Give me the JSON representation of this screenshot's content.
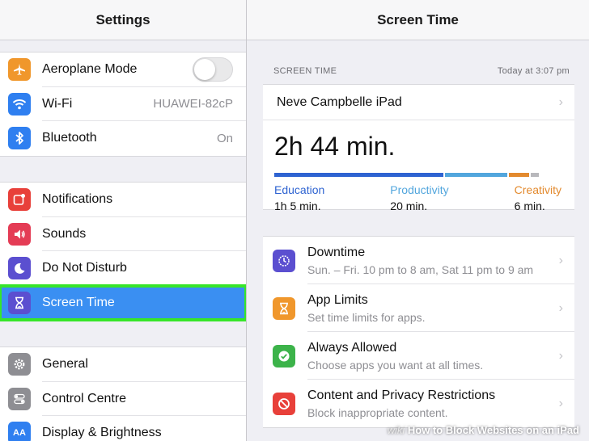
{
  "settings": {
    "title": "Settings",
    "group1": [
      {
        "label": "Aeroplane Mode",
        "icon": "airplane-icon",
        "color": "#f0972c",
        "toggle": false
      },
      {
        "label": "Wi-Fi",
        "icon": "wifi-icon",
        "color": "#2f7ff0",
        "value": "HUAWEI-82cP"
      },
      {
        "label": "Bluetooth",
        "icon": "bluetooth-icon",
        "color": "#2f7ff0",
        "value": "On"
      }
    ],
    "group2": [
      {
        "label": "Notifications",
        "icon": "notifications-icon",
        "color": "#e8403a"
      },
      {
        "label": "Sounds",
        "icon": "speaker-icon",
        "color": "#e43c55"
      },
      {
        "label": "Do Not Disturb",
        "icon": "moon-icon",
        "color": "#5b4fd0"
      },
      {
        "label": "Screen Time",
        "icon": "hourglass-icon",
        "color": "#5b4fd0",
        "selected": true
      }
    ],
    "group3": [
      {
        "label": "General",
        "icon": "gear-icon",
        "color": "#8e8e93"
      },
      {
        "label": "Control Centre",
        "icon": "toggles-icon",
        "color": "#8e8e93"
      },
      {
        "label": "Display & Brightness",
        "icon": "text-size-icon",
        "color": "#2f7ff0"
      }
    ]
  },
  "screen_time": {
    "title": "Screen Time",
    "section_label": "SCREEN TIME",
    "timestamp": "Today at 3:07 pm",
    "device": "Neve Campbelle iPad",
    "total": "2h 44 min.",
    "bar": [
      {
        "fraction": 0.6,
        "color": "#2e63d1"
      },
      {
        "fraction": 0.22,
        "color": "#52a6dd"
      },
      {
        "fraction": 0.07,
        "color": "#e38a2e"
      },
      {
        "fraction": 0.03,
        "color": "#b8b8bc"
      }
    ],
    "categories": [
      {
        "name": "Education",
        "time": "1h 5 min.",
        "color": "#2e63d1"
      },
      {
        "name": "Productivity",
        "time": "20 min.",
        "color": "#52a6dd"
      },
      {
        "name": "Creativity",
        "time": "6 min.",
        "color": "#e38a2e"
      }
    ],
    "options": [
      {
        "title": "Downtime",
        "sub": "Sun. – Fri. 10 pm to 8 am, Sat 11 pm to 9 am",
        "icon": "downtime-icon",
        "color": "#5b4fd0"
      },
      {
        "title": "App Limits",
        "sub": "Set time limits for apps.",
        "icon": "hourglass-icon",
        "color": "#f0972c"
      },
      {
        "title": "Always Allowed",
        "sub": "Choose apps you want at all times.",
        "icon": "checkmark-icon",
        "color": "#3cb34a"
      },
      {
        "title": "Content and Privacy Restrictions",
        "sub": "Block inappropriate content.",
        "icon": "restriction-icon",
        "color": "#e8403a"
      }
    ]
  },
  "watermark": {
    "brand": "wiki",
    "text": "How to Block Websites on an iPad"
  }
}
